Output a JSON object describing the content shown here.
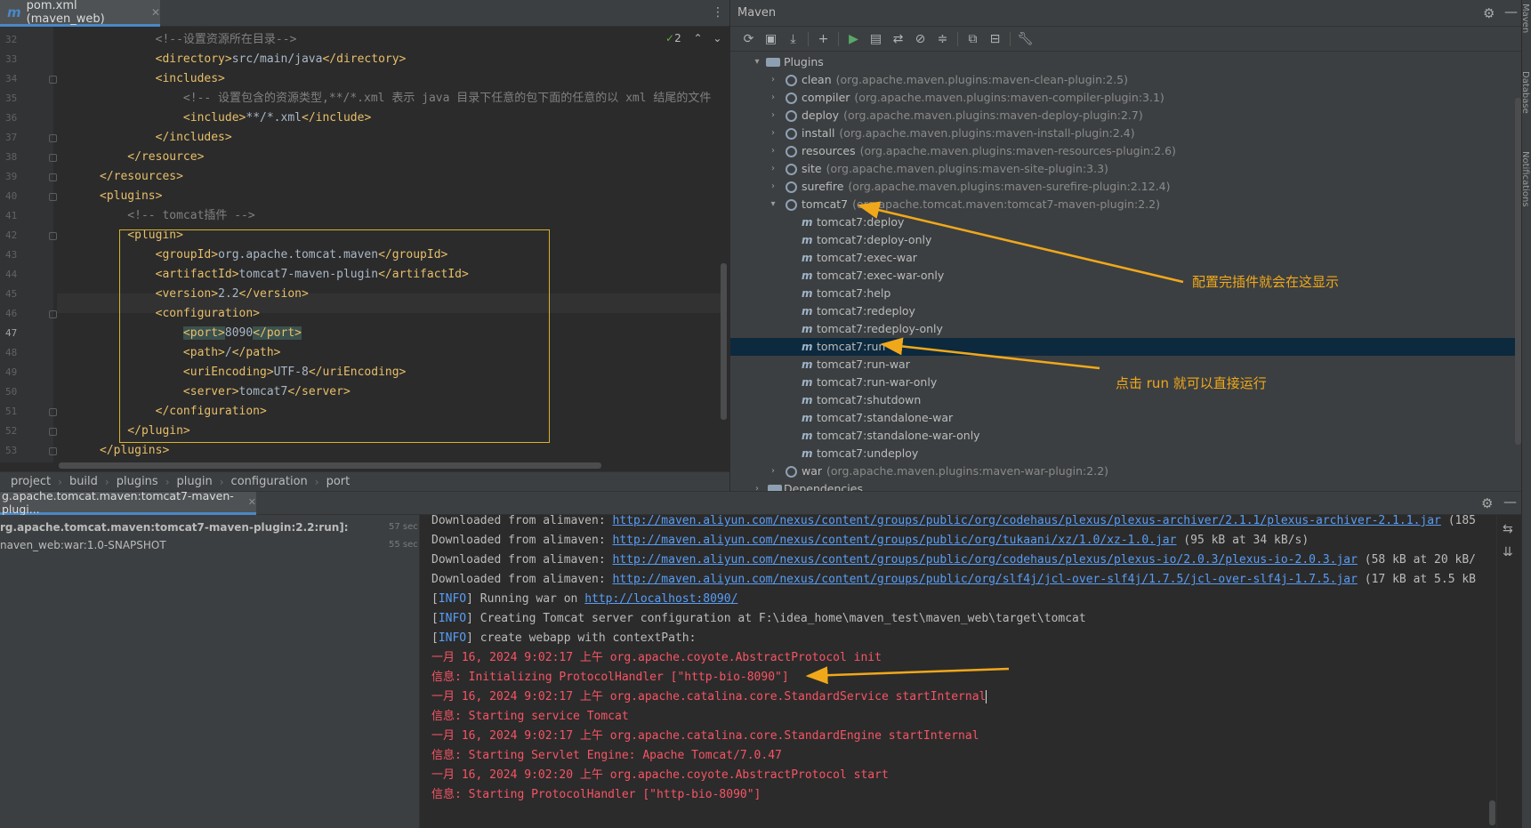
{
  "editor": {
    "tab_label": "pom.xml (maven_web)",
    "tab_icon": "m",
    "inspection_count": "2",
    "lines": [
      {
        "no": "32",
        "text": "        <!--设置资源所在目录-->",
        "kind": "comment"
      },
      {
        "no": "33",
        "text": "        <directory>src/main/java</directory>",
        "kind": "tag"
      },
      {
        "no": "34",
        "text": "        <includes>",
        "kind": "tag"
      },
      {
        "no": "35",
        "text": "            <!-- 设置包含的资源类型,**/*.xml 表示 java 目录下任意的包下面的任意的以 xml 结尾的文件",
        "kind": "comment"
      },
      {
        "no": "36",
        "text": "            <include>**/*.xml</include>",
        "kind": "tag"
      },
      {
        "no": "37",
        "text": "        </includes>",
        "kind": "tag"
      },
      {
        "no": "38",
        "text": "    </resource>",
        "kind": "tag"
      },
      {
        "no": "39",
        "text": "</resources>",
        "kind": "tag"
      },
      {
        "no": "40",
        "text": "<plugins>",
        "kind": "tag"
      },
      {
        "no": "41",
        "text": "    <!-- tomcat插件 -->",
        "kind": "comment"
      },
      {
        "no": "42",
        "text": "    <plugin>",
        "kind": "tag"
      },
      {
        "no": "43",
        "text": "        <groupId>org.apache.tomcat.maven</groupId>",
        "kind": "tag"
      },
      {
        "no": "44",
        "text": "        <artifactId>tomcat7-maven-plugin</artifactId>",
        "kind": "tag"
      },
      {
        "no": "45",
        "text": "        <version>2.2</version>",
        "kind": "tag"
      },
      {
        "no": "46",
        "text": "        <configuration>",
        "kind": "tag"
      },
      {
        "no": "47",
        "text": "            <port>8090</port>",
        "kind": "tag"
      },
      {
        "no": "48",
        "text": "            <path>/</path>",
        "kind": "tag"
      },
      {
        "no": "49",
        "text": "            <uriEncoding>UTF-8</uriEncoding>",
        "kind": "tag"
      },
      {
        "no": "50",
        "text": "            <server>tomcat7</server>",
        "kind": "tag"
      },
      {
        "no": "51",
        "text": "        </configuration>",
        "kind": "tag"
      },
      {
        "no": "52",
        "text": "    </plugin>",
        "kind": "tag"
      },
      {
        "no": "53",
        "text": "</plugins>",
        "kind": "tag"
      }
    ],
    "breadcrumb": [
      "project",
      "build",
      "plugins",
      "plugin",
      "configuration",
      "port"
    ]
  },
  "maven": {
    "title": "Maven",
    "plugins_label": "Plugins",
    "plugins": [
      {
        "name": "clean",
        "coord": "(org.apache.maven.plugins:maven-clean-plugin:2.5)"
      },
      {
        "name": "compiler",
        "coord": "(org.apache.maven.plugins:maven-compiler-plugin:3.1)"
      },
      {
        "name": "deploy",
        "coord": "(org.apache.maven.plugins:maven-deploy-plugin:2.7)"
      },
      {
        "name": "install",
        "coord": "(org.apache.maven.plugins:maven-install-plugin:2.4)"
      },
      {
        "name": "resources",
        "coord": "(org.apache.maven.plugins:maven-resources-plugin:2.6)"
      },
      {
        "name": "site",
        "coord": "(org.apache.maven.plugins:maven-site-plugin:3.3)"
      },
      {
        "name": "surefire",
        "coord": "(org.apache.maven.plugins:maven-surefire-plugin:2.12.4)"
      },
      {
        "name": "tomcat7",
        "coord": "(org.apache.tomcat.maven:tomcat7-maven-plugin:2.2)"
      }
    ],
    "goals": [
      "tomcat7:deploy",
      "tomcat7:deploy-only",
      "tomcat7:exec-war",
      "tomcat7:exec-war-only",
      "tomcat7:help",
      "tomcat7:redeploy",
      "tomcat7:redeploy-only",
      "tomcat7:run",
      "tomcat7:run-war",
      "tomcat7:run-war-only",
      "tomcat7:shutdown",
      "tomcat7:standalone-war",
      "tomcat7:standalone-war-only",
      "tomcat7:undeploy"
    ],
    "selected_goal": "tomcat7:run",
    "war": {
      "name": "war",
      "coord": "(org.apache.maven.plugins:maven-war-plugin:2.2)"
    },
    "dependencies_label": "Dependencies",
    "annotation_plugin": "配置完插件就会在这显示",
    "annotation_run": "点击 run 就可以直接运行"
  },
  "run": {
    "tab_label": "g.apache.tomcat.maven:tomcat7-maven-plugi...",
    "tree": [
      {
        "text": "rg.apache.tomcat.maven:tomcat7-maven-plugin:2.2:run]:",
        "time": "57 sec",
        "bold": true
      },
      {
        "text": "naven_web:war:1.0-SNAPSHOT",
        "time": "55 sec",
        "bold": false
      }
    ],
    "console": [
      {
        "kind": "dl",
        "prefix": "Downloaded from alimaven: ",
        "link": "http://maven.aliyun.com/nexus/content/groups/public/org/codehaus/plexus/plexus-archiver/2.1.1/plexus-archiver-2.1.1.jar",
        "suffix": " (185"
      },
      {
        "kind": "dl",
        "prefix": "Downloaded from alimaven: ",
        "link": "http://maven.aliyun.com/nexus/content/groups/public/org/tukaani/xz/1.0/xz-1.0.jar",
        "suffix": " (95 kB at 34 kB/s)"
      },
      {
        "kind": "dl",
        "prefix": "Downloaded from alimaven: ",
        "link": "http://maven.aliyun.com/nexus/content/groups/public/org/codehaus/plexus/plexus-io/2.0.3/plexus-io-2.0.3.jar",
        "suffix": " (58 kB at 20 kB/"
      },
      {
        "kind": "dl",
        "prefix": "Downloaded from alimaven: ",
        "link": "http://maven.aliyun.com/nexus/content/groups/public/org/slf4j/jcl-over-slf4j/1.7.5/jcl-over-slf4j-1.7.5.jar",
        "suffix": " (17 kB at 5.5 kB"
      },
      {
        "kind": "info",
        "tag": "INFO",
        "text": " Running war on ",
        "link": "http://localhost:8090/"
      },
      {
        "kind": "info",
        "tag": "INFO",
        "text": " Creating Tomcat server configuration at F:\\idea_home\\maven_test\\maven_web\\target\\tomcat",
        "link": ""
      },
      {
        "kind": "info",
        "tag": "INFO",
        "text": " create webapp with contextPath:",
        "link": ""
      },
      {
        "kind": "red",
        "text": "一月 16, 2024 9:02:17 上午 org.apache.coyote.AbstractProtocol init"
      },
      {
        "kind": "red",
        "text": "信息: Initializing ProtocolHandler [\"http-bio-8090\"]"
      },
      {
        "kind": "red",
        "text": "一月 16, 2024 9:02:17 上午 org.apache.catalina.core.StandardService startInternal"
      },
      {
        "kind": "red",
        "text": "信息: Starting service Tomcat"
      },
      {
        "kind": "red",
        "text": "一月 16, 2024 9:02:17 上午 org.apache.catalina.core.StandardEngine startInternal"
      },
      {
        "kind": "red",
        "text": "信息: Starting Servlet Engine: Apache Tomcat/7.0.47"
      },
      {
        "kind": "red",
        "text": "一月 16, 2024 9:02:20 上午 org.apache.coyote.AbstractProtocol start"
      },
      {
        "kind": "red",
        "text": "信息: Starting ProtocolHandler [\"http-bio-8090\"]"
      }
    ]
  },
  "stripe": {
    "labels": [
      "Maven",
      "Database",
      "Notifications"
    ]
  },
  "colors": {
    "accent": "#4a88c7",
    "annotation": "#f0a81b",
    "console_red": "#f75464",
    "xml_tag": "#e8bf6a",
    "comment": "#808080",
    "selection": "#0d293e"
  }
}
